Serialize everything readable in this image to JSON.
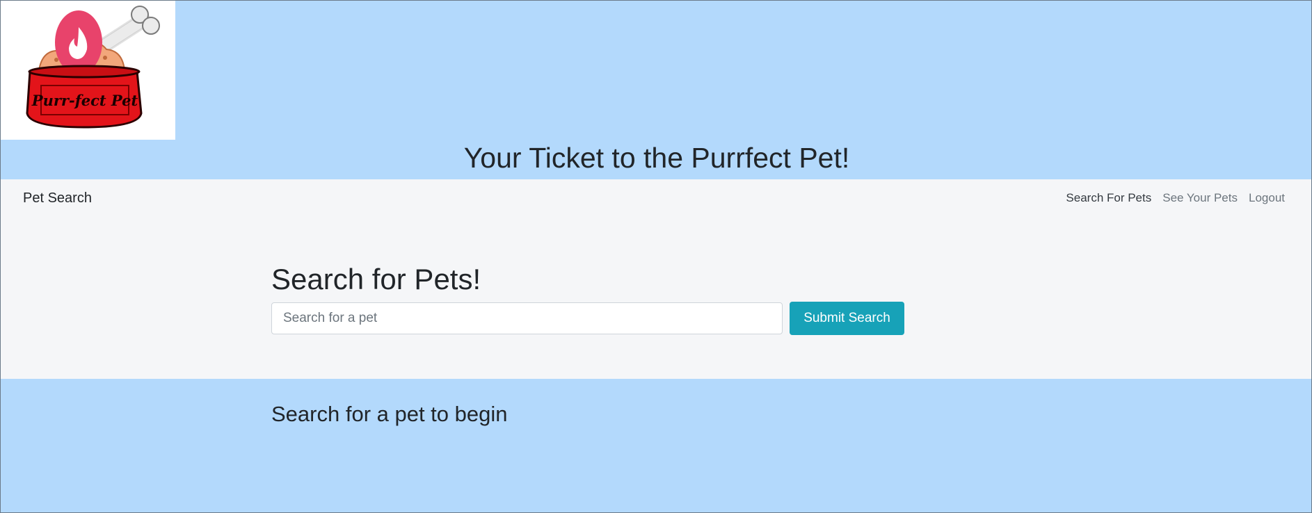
{
  "logo": {
    "text": "Purr-fect Pet",
    "icon": "pet-bowl-logo-icon"
  },
  "hero": {
    "title": "Your Ticket to the Purrfect Pet!"
  },
  "navbar": {
    "brand": "Pet Search",
    "links": [
      {
        "label": "Search For Pets",
        "active": true
      },
      {
        "label": "See Your Pets",
        "active": false
      },
      {
        "label": "Logout",
        "active": false
      }
    ]
  },
  "search": {
    "heading": "Search for Pets!",
    "placeholder": "Search for a pet",
    "value": "",
    "submit_label": "Submit Search"
  },
  "results": {
    "message": "Search for a pet to begin"
  },
  "colors": {
    "page_bg": "#b3d9fc",
    "navbar_bg": "#f5f6f8",
    "button": "#17a2b8",
    "logo_pink": "#e8436b",
    "bowl_red": "#e3141a"
  }
}
